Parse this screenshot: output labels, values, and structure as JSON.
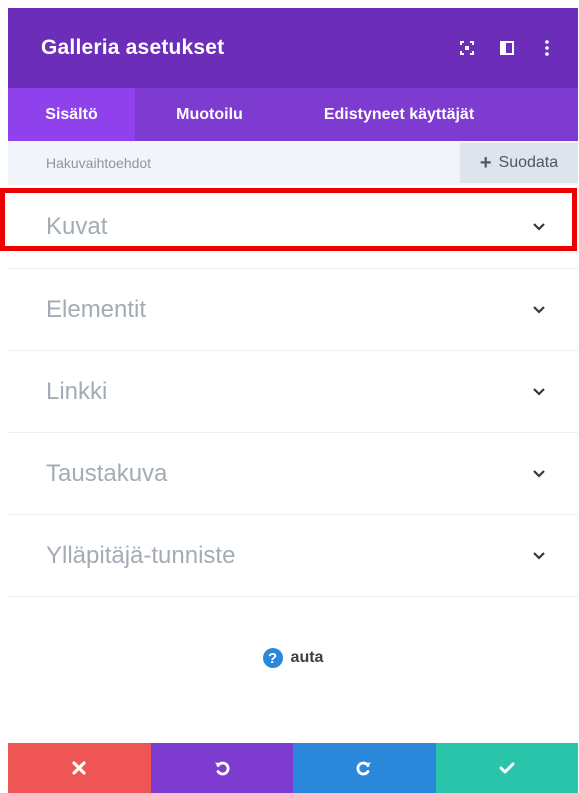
{
  "header": {
    "title": "Galleria asetukset",
    "icons": [
      "expand-icon",
      "split-view-icon",
      "more-vertical-icon"
    ]
  },
  "tabs": [
    {
      "label": "Sisältö",
      "active": true
    },
    {
      "label": "Muotoilu",
      "active": false
    },
    {
      "label": "Edistyneet käyttäjät",
      "active": false
    }
  ],
  "filter_bar": {
    "search_label": "Hakuvaihtoehdot",
    "filter_button_label": "Suodata"
  },
  "sections": [
    {
      "label": "Kuvat",
      "highlighted": true
    },
    {
      "label": "Elementit"
    },
    {
      "label": "Linkki"
    },
    {
      "label": "Taustakuva"
    },
    {
      "label": "Ylläpitäjä-tunniste"
    }
  ],
  "help": {
    "label": "auta"
  },
  "footer": {
    "buttons": [
      "close-icon",
      "undo-icon",
      "redo-icon",
      "check-icon"
    ]
  },
  "colors": {
    "header": "#6c2eb9",
    "tabs": "#7e3bd0",
    "active_tab": "#8f42ec",
    "cancel": "#ef5555",
    "undo": "#7e3bd0",
    "redo": "#2b87da",
    "save": "#29c4a9",
    "highlight": "#ee0000"
  }
}
